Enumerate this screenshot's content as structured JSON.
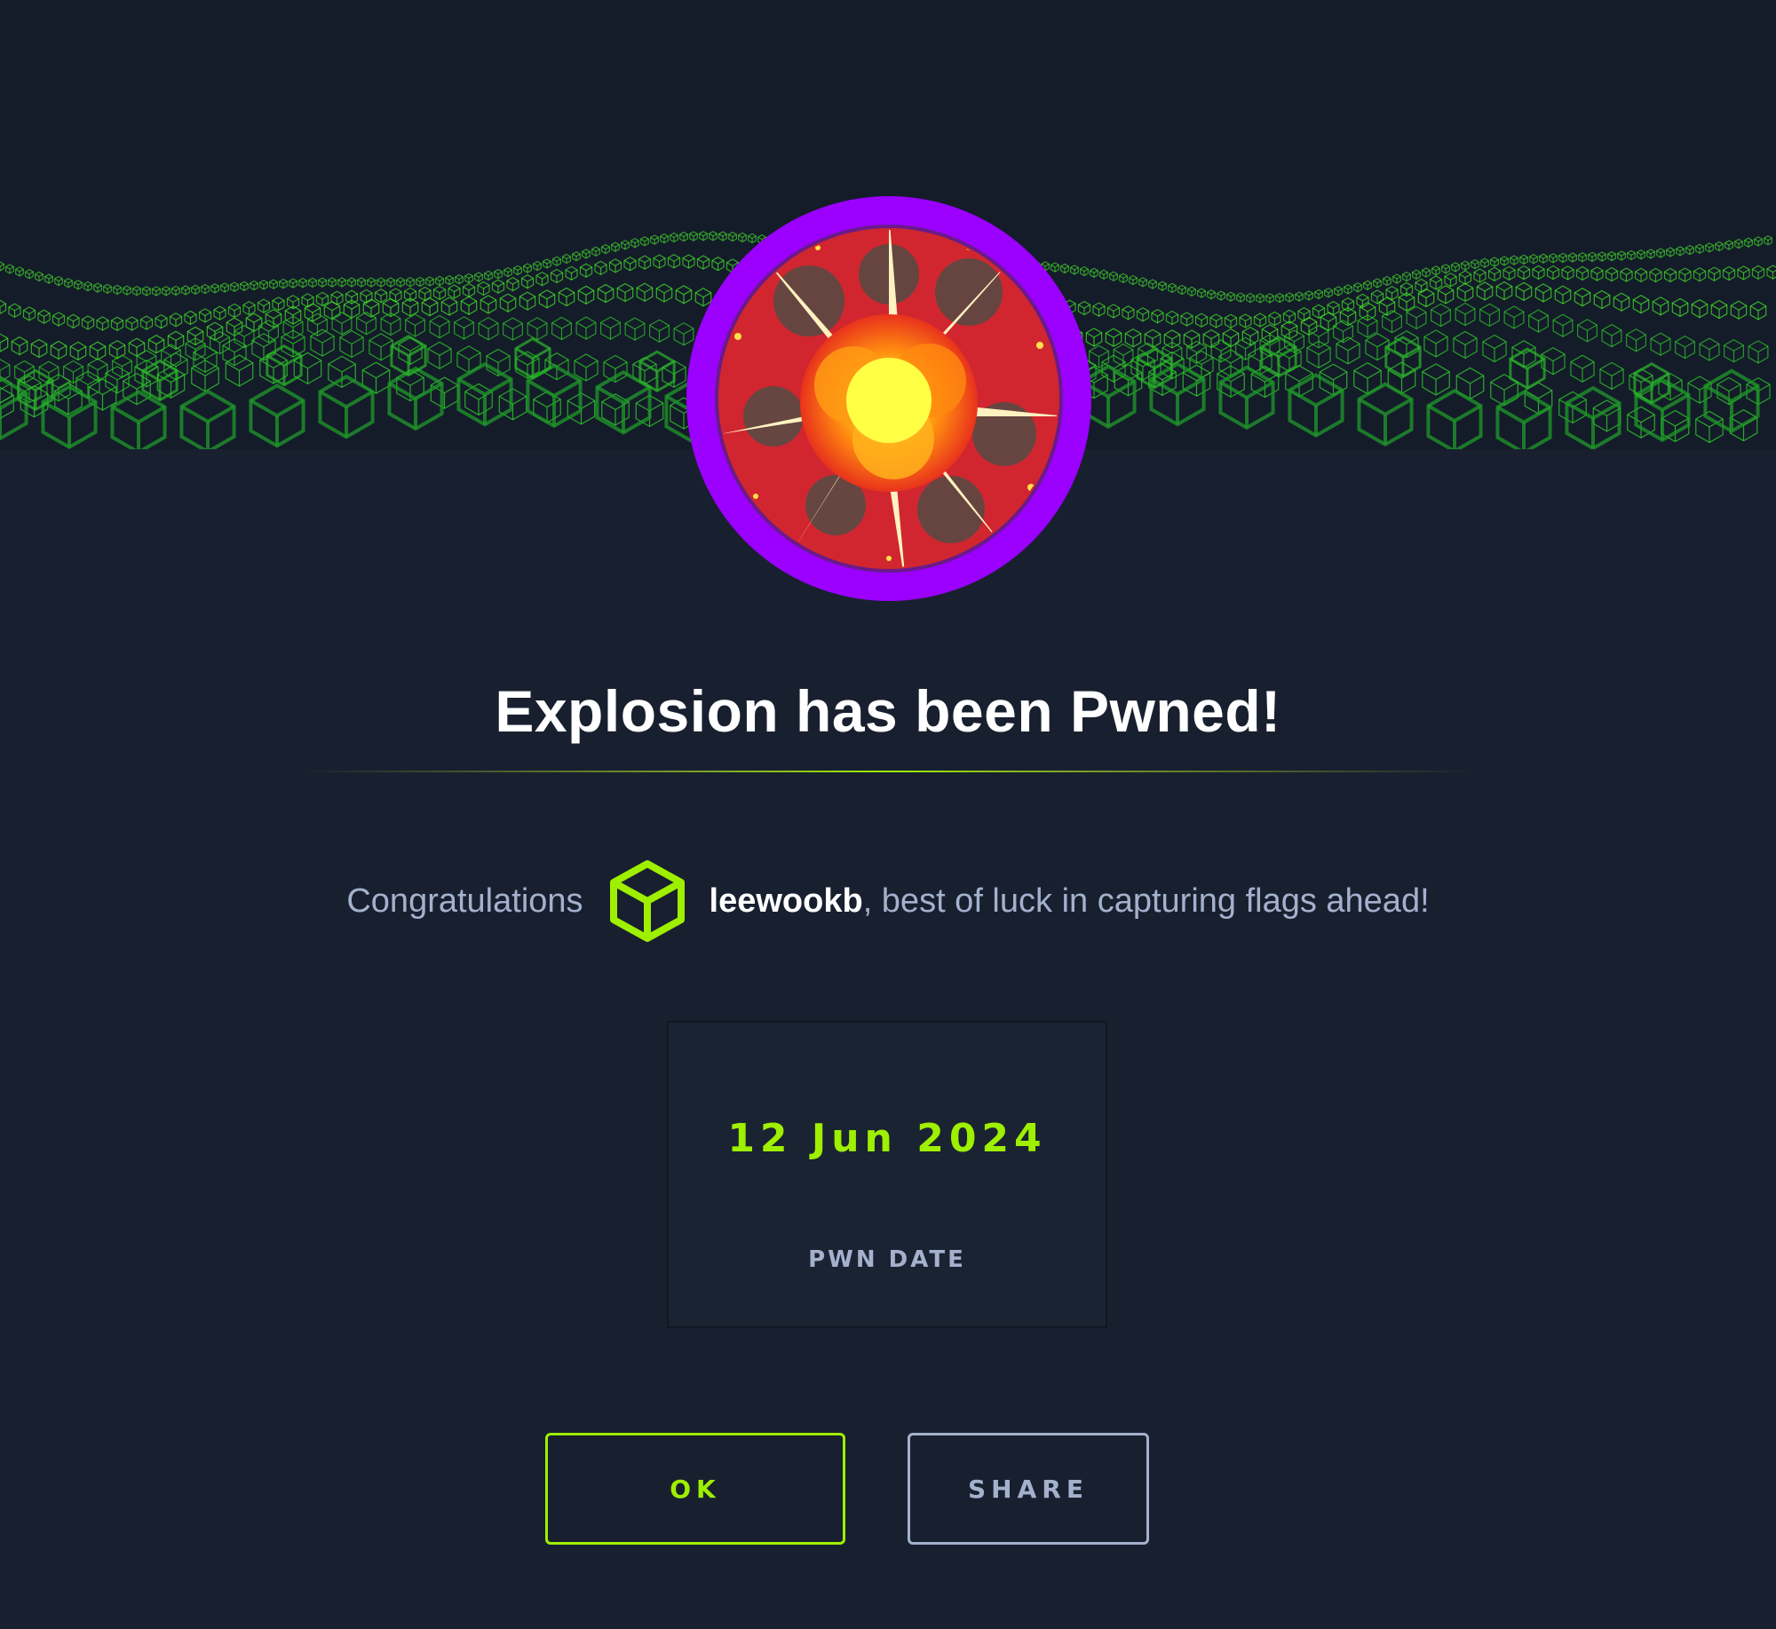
{
  "modal": {
    "title": "Explosion has been Pwned!",
    "congrats_prefix": "Congratulations",
    "username": "leewookb",
    "congrats_suffix": ", best of luck in capturing flags ahead!",
    "stat": {
      "value": "12 Jun 2024",
      "label": "PWN DATE"
    },
    "buttons": {
      "ok_label": "OK",
      "share_label": "SHARE"
    }
  },
  "icons": {
    "banner": "green-cube-wave-banner",
    "badge": "explosion-machine-badge",
    "user": "hackthebox-cube-icon"
  },
  "colors": {
    "background": "#182030",
    "accent": "#9fef00",
    "badge_ring": "#9b00ff",
    "muted_text": "#a4b1cd",
    "title_text": "#ffffff"
  }
}
